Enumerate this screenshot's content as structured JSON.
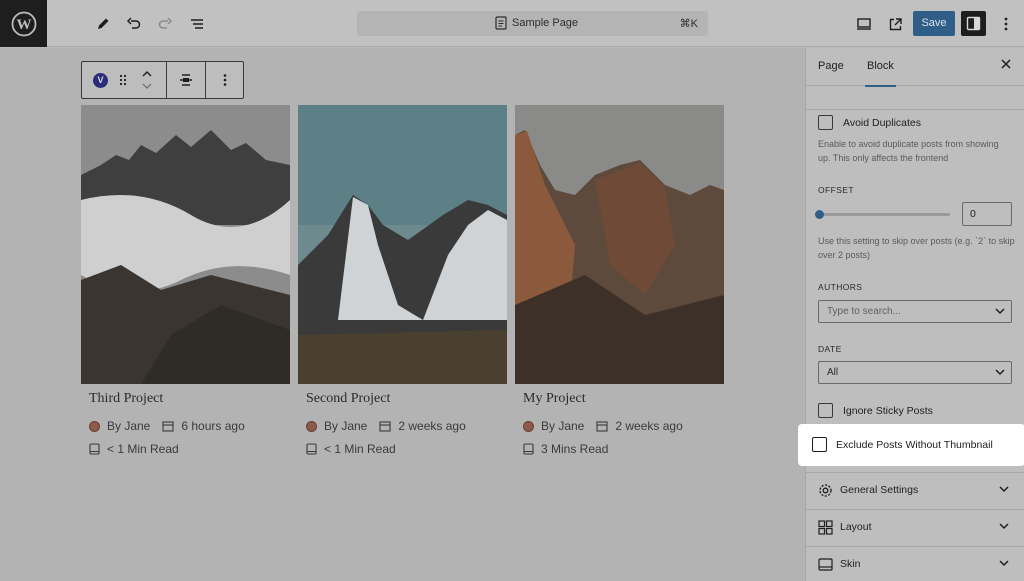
{
  "topbar": {
    "document_title": "Sample Page",
    "shortcut": "⌘K",
    "save_label": "Save"
  },
  "block_toolbar": {
    "badge_letter": "V"
  },
  "posts": [
    {
      "title": "Third Project",
      "author": "By Jane",
      "date": "6 hours ago",
      "read_time": "< 1 Min Read"
    },
    {
      "title": "Second Project",
      "author": "By Jane",
      "date": "2 weeks ago",
      "read_time": "< 1 Min Read"
    },
    {
      "title": "My Project",
      "author": "By Jane",
      "date": "2 weeks ago",
      "read_time": "3 Mins Read"
    }
  ],
  "sidebar": {
    "tabs": [
      "Page",
      "Block"
    ],
    "active_tab": "Block",
    "avoid_duplicates": {
      "label": "Avoid Duplicates",
      "help": "Enable to avoid duplicate posts from showing up. This only affects the frontend",
      "checked": false
    },
    "offset": {
      "label": "OFFSET",
      "value": "0",
      "help": "Use this setting to skip over posts (e.g. `2` to skip over 2 posts)"
    },
    "authors": {
      "label": "AUTHORS",
      "placeholder": "Type to search..."
    },
    "date": {
      "label": "DATE",
      "selected": "All"
    },
    "ignore_sticky": {
      "label": "Ignore Sticky Posts",
      "checked": false
    },
    "exclude_no_thumb": {
      "label": "Exclude Posts Without Thumbnail",
      "checked": false
    },
    "panels": [
      {
        "label": "General Settings",
        "icon": "gear-icon"
      },
      {
        "label": "Layout",
        "icon": "layout-grid-icon"
      },
      {
        "label": "Skin",
        "icon": "skin-icon"
      }
    ]
  },
  "colors": {
    "accent": "#3858e9",
    "overlay_bg": "#b9b9b9",
    "highlight": "#ffffff"
  }
}
